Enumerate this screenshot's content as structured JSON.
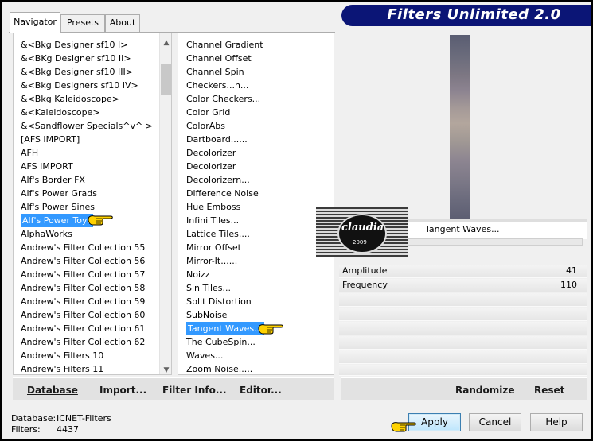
{
  "window": {
    "title": "Filters Unlimited 2.0"
  },
  "tabs": [
    {
      "label": "Navigator"
    },
    {
      "label": "Presets"
    },
    {
      "label": "About"
    }
  ],
  "categories": {
    "items": [
      "&<Bkg Designer sf10 I>",
      "&<BKg Designer sf10 II>",
      "&<Bkg Designer sf10 III>",
      "&<Bkg Designers sf10 IV>",
      "&<Bkg Kaleidoscope>",
      "&<Kaleidoscope>",
      "&<Sandflower Specials^v^ >",
      "[AFS IMPORT]",
      "AFH",
      "AFS IMPORT",
      "Alf's Border FX",
      "Alf's Power Grads",
      "Alf's Power Sines",
      "Alf's Power Toys",
      "AlphaWorks",
      "Andrew's Filter Collection 55",
      "Andrew's Filter Collection 56",
      "Andrew's Filter Collection 57",
      "Andrew's Filter Collection 58",
      "Andrew's Filter Collection 59",
      "Andrew's Filter Collection 60",
      "Andrew's Filter Collection 61",
      "Andrew's Filter Collection 62",
      "Andrew's Filters 10",
      "Andrew's Filters 11"
    ],
    "selected": "Alf's Power Toys"
  },
  "filters": {
    "items": [
      "Channel Gradient",
      "Channel Offset",
      "Channel Spin",
      "Checkers...n...",
      "Color Checkers...",
      "Color Grid",
      "ColorAbs",
      "Dartboard......",
      "Decolorizer",
      "Decolorizer",
      "Decolorizern...",
      "Difference Noise",
      "Hue Emboss",
      "Infini Tiles...",
      "Lattice Tiles....",
      "Mirror Offset",
      "Mirror-It......",
      "Noizz",
      "Sin Tiles...",
      "Split Distortion",
      "SubNoise",
      "Tangent Waves...",
      "The CubeSpin...",
      "Waves...",
      "Zoom Noise....."
    ],
    "selected": "Tangent Waves..."
  },
  "preview": {
    "filter_name": "Tangent Waves..."
  },
  "params": [
    {
      "label": "Amplitude",
      "value": "41"
    },
    {
      "label": "Frequency",
      "value": "110"
    }
  ],
  "logo": {
    "text": "claudia",
    "sub": "2009"
  },
  "left_buttons": {
    "database": "Database",
    "import": "Import...",
    "filter_info": "Filter Info...",
    "editor": "Editor..."
  },
  "right_buttons": {
    "randomize": "Randomize",
    "reset": "Reset"
  },
  "status": {
    "database_label": "Database:",
    "database_value": "ICNET-Filters",
    "filters_label": "Filters:",
    "filters_value": "4437"
  },
  "dialog_buttons": {
    "apply": "Apply",
    "cancel": "Cancel",
    "help": "Help"
  },
  "colors": {
    "banner": "#0b1576",
    "selection": "#3399ff",
    "pointer": "#ffd200"
  }
}
